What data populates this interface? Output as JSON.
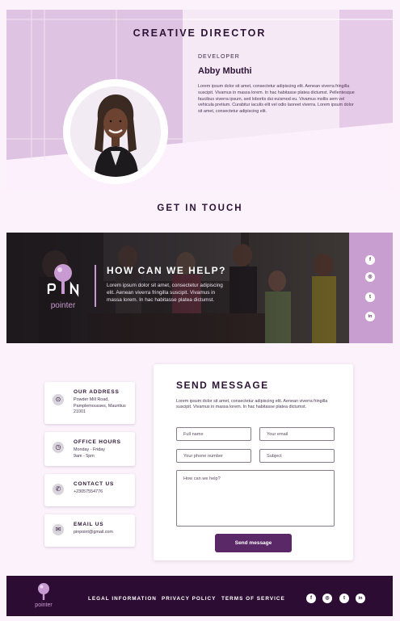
{
  "hero": {
    "title": "CREATIVE DIRECTOR",
    "role": "DEVELOPER",
    "name": "Abby Mbuthi",
    "bio": "Lorem ipsum dolor sit amet, consectetur adipiscing elit. Aenean viverra fringilla suscipit. Vivamus in massa lorem. In hac habitasse platea dictumst. Pellentesque faucibus viverra ipsum, sed lobortis dui euismod eu. Vivamus mollis sem vel vehicula pretium. Curabitur iaculis elit vel odio laoreet viverra. Lorem ipsum dolor sit amet, consectetur adipiscing elit."
  },
  "touch": {
    "title": "GET IN TOUCH"
  },
  "help": {
    "logo_top": "P  N",
    "logo_word": "pointer",
    "title": "HOW CAN WE HELP?",
    "text": "Lorem ipsum dolor sit amet, consectetur adipiscing elit. Aenean viverra fringilla suscipit. Vivamus in massa lorem. In hac habitasse platea dictumst."
  },
  "social": {
    "facebook": "f",
    "instagram": "◎",
    "twitter": "t",
    "linkedin": "in"
  },
  "contact_cards": [
    {
      "title": "OUR ADDRESS",
      "value": "Powder Mill Road, Pamplemousses, Mauritius 21001",
      "icon": "location-icon"
    },
    {
      "title": "OFFICE HOURS",
      "value": "Monday - Friday 9am - 5pm",
      "icon": "clock-icon"
    },
    {
      "title": "CONTACT US",
      "value": "+23057554776",
      "icon": "phone-icon"
    },
    {
      "title": "EMAIL US",
      "value": "pinpoint@gmail.com",
      "icon": "mail-icon"
    }
  ],
  "form": {
    "title": "SEND MESSAGE",
    "desc": "Lorem ipsum dolor sit amet, consectetur adipiscing elit. Aenean viverra fringilla suscipit. Vivamus in massa lorem. In hac habitasse platea dictumst.",
    "full_name": "Full name",
    "email": "Your email",
    "phone": "Your phone number",
    "subject": "Subject",
    "message": "How can we help?",
    "send": "Send message"
  },
  "footer": {
    "logo_word": "pointer",
    "links": [
      "LEGAL INFORMATION",
      "PRIVACY POLICY",
      "TERMS OF SERVICE"
    ]
  },
  "colors": {
    "accent": "#5b2867",
    "lavender": "#c89ed0",
    "dark": "#2d0c33",
    "hero_tint": "#e6cbe8"
  }
}
